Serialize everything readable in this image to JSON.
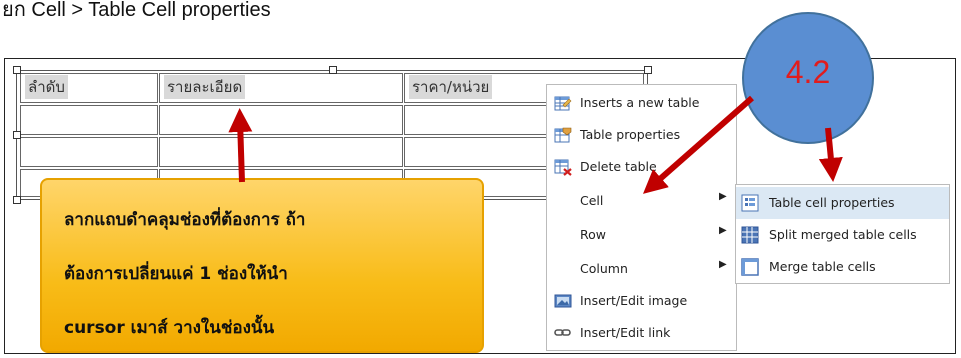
{
  "heading": "ยก Cell > Table Cell properties",
  "table": {
    "headers": [
      "ลำดับ",
      "รายละเอียด",
      "ราคา/หน่วย"
    ]
  },
  "context_menu": {
    "items": [
      {
        "label": "Inserts a new table",
        "icon": "insert-table-icon",
        "submenu": false
      },
      {
        "label": "Table properties",
        "icon": "table-properties-icon",
        "submenu": false
      },
      {
        "label": "Delete table",
        "icon": "delete-table-icon",
        "submenu": false
      },
      {
        "label": "Cell",
        "icon": "",
        "submenu": true
      },
      {
        "label": "Row",
        "icon": "",
        "submenu": true
      },
      {
        "label": "Column",
        "icon": "",
        "submenu": true
      },
      {
        "label": "Insert/Edit image",
        "icon": "image-icon",
        "submenu": false
      },
      {
        "label": "Insert/Edit link",
        "icon": "link-icon",
        "submenu": false
      }
    ]
  },
  "cell_submenu": {
    "items": [
      {
        "label": "Table cell properties",
        "icon": "cell-properties-icon",
        "highlighted": true
      },
      {
        "label": "Split merged table cells",
        "icon": "split-cells-icon",
        "highlighted": false
      },
      {
        "label": "Merge table cells",
        "icon": "merge-cells-icon",
        "highlighted": false
      }
    ]
  },
  "callout": {
    "lines": [
      "ลากแถบดำคลุมช่องที่ต้องการ ถ้า",
      "ต้องการเปลี่ยนแค่ 1 ช่องให้นำ",
      "cursor เมาส์ วางในช่องนั้น"
    ]
  },
  "step_bubble": {
    "label": "4.2"
  },
  "colors": {
    "arrow": "#c00000",
    "bubble": "#5a8ed2",
    "bubble_text": "#e11c1c",
    "callout": "#f8bc18",
    "submenu_highlight": "#dbe8f4"
  }
}
